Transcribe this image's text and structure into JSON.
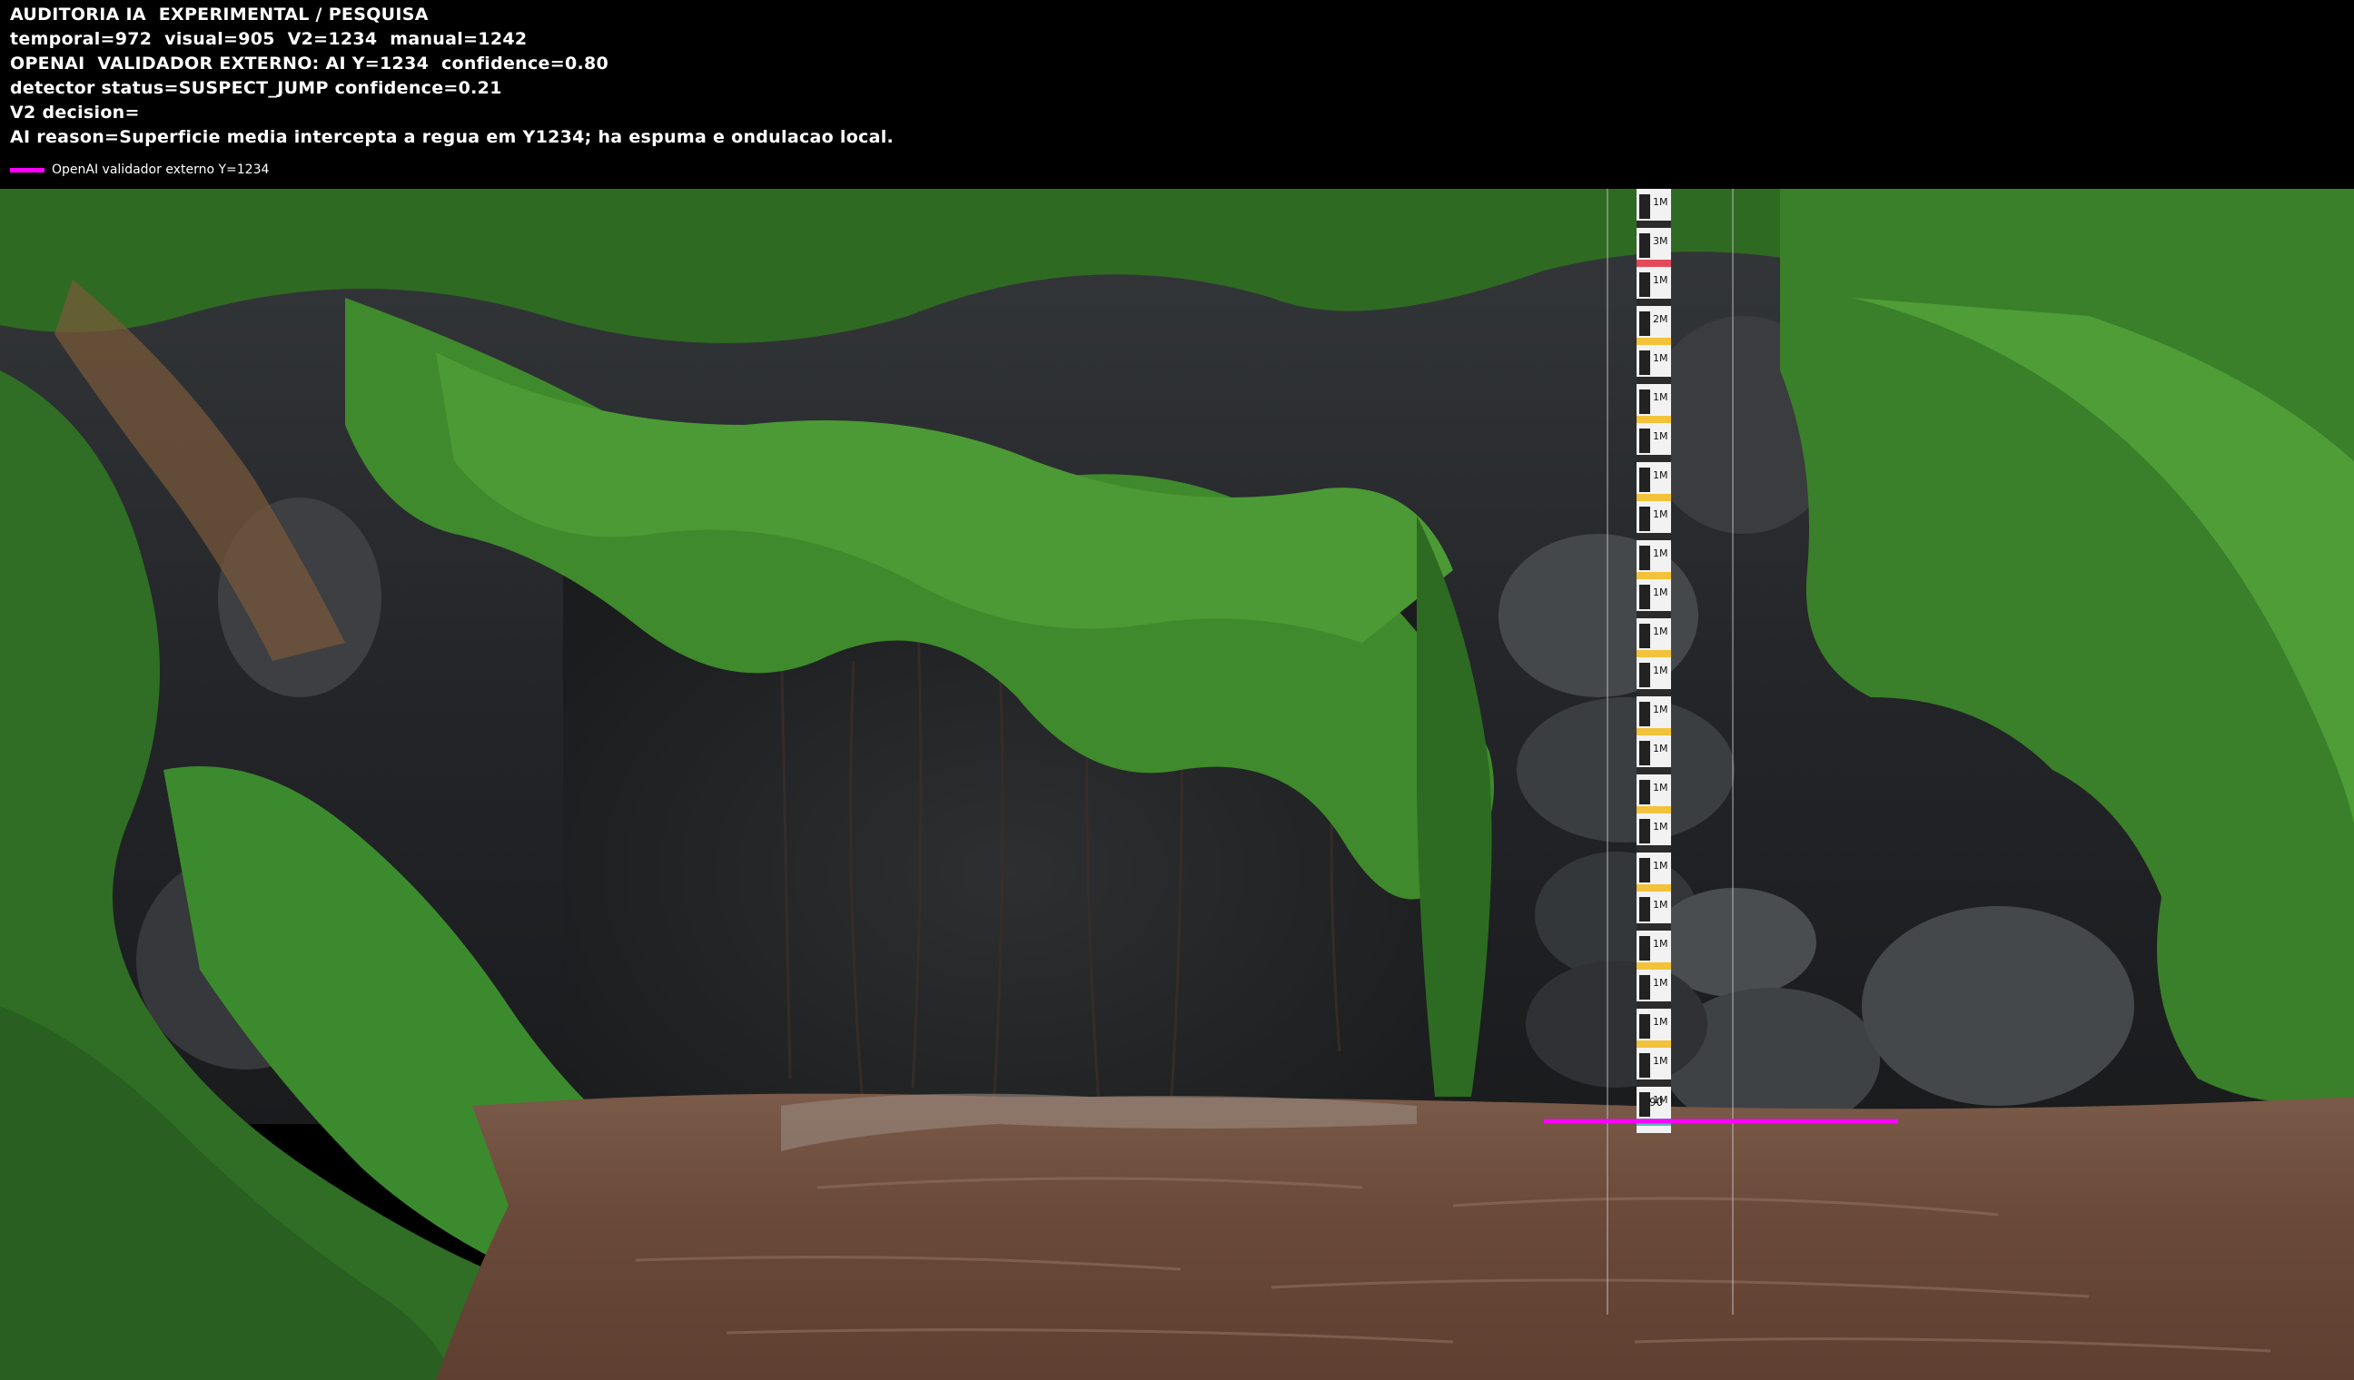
{
  "overlay": {
    "lines": [
      "AUDITORIA IA  EXPERIMENTAL / PESQUISA",
      "temporal=972  visual=905  V2=1234  manual=1242",
      "OPENAI  VALIDADOR EXTERNO: AI Y=1234  confidence=0.80",
      "detector status=SUSPECT_JUMP confidence=0.21",
      "V2 decision=",
      "AI reason=Superficie media intercepta a regua em Y1234; ha espuma e ondulacao local."
    ],
    "legend_label": "OpenAI validador externo Y=1234"
  },
  "colors": {
    "header_bg": "#000000",
    "text": "#ffffff",
    "ai_line": "#ff00ff",
    "water": "#6e4c3c",
    "rock": "#2a2b2c",
    "foliage": "#3c7a2a"
  },
  "gauge": {
    "labels": [
      "1M",
      "3M",
      "1M",
      "2M",
      "1M",
      "1M",
      "1M",
      "1M",
      "1M",
      "1M",
      "1M",
      "1M",
      "1M",
      "1M",
      "1M",
      "1M",
      "1M",
      "1M",
      "1M",
      "1M",
      "1M",
      "1M",
      "1M",
      "1M"
    ],
    "minor_labels": [
      "50",
      "30",
      "10",
      "90",
      "70",
      "50",
      "30",
      "10",
      "90",
      "70",
      "50",
      "30",
      "10",
      "90"
    ],
    "bottom_label": "90"
  }
}
